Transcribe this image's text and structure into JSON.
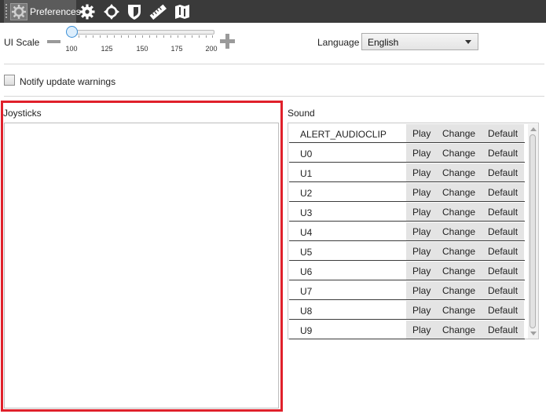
{
  "toolbar": {
    "active_tab_label": "Preferences",
    "tabs": [
      {
        "icon": "gear-icon"
      },
      {
        "icon": "joystick-icon"
      },
      {
        "icon": "shield-icon"
      },
      {
        "icon": "ruler-icon"
      },
      {
        "icon": "map-icon"
      }
    ]
  },
  "scale": {
    "label": "UI Scale",
    "value": 100,
    "min": 100,
    "max": 200,
    "tick_labels": [
      "100",
      "125",
      "150",
      "175",
      "200"
    ]
  },
  "language": {
    "label": "Language",
    "selected": "English"
  },
  "notify": {
    "label": "Notify update warnings",
    "checked": false
  },
  "joysticks": {
    "label": "Joysticks",
    "items": []
  },
  "sound": {
    "label": "Sound",
    "play_label": "Play",
    "change_label": "Change",
    "default_label": "Default",
    "items": [
      {
        "name": "ALERT_AUDIOCLIP"
      },
      {
        "name": "U0"
      },
      {
        "name": "U1"
      },
      {
        "name": "U2"
      },
      {
        "name": "U3"
      },
      {
        "name": "U4"
      },
      {
        "name": "U5"
      },
      {
        "name": "U6"
      },
      {
        "name": "U7"
      },
      {
        "name": "U8"
      },
      {
        "name": "U9"
      }
    ]
  },
  "colors": {
    "highlight": "#e0202b",
    "topbar": "#3a3a3a",
    "slider_accent": "#3b8fd6"
  }
}
